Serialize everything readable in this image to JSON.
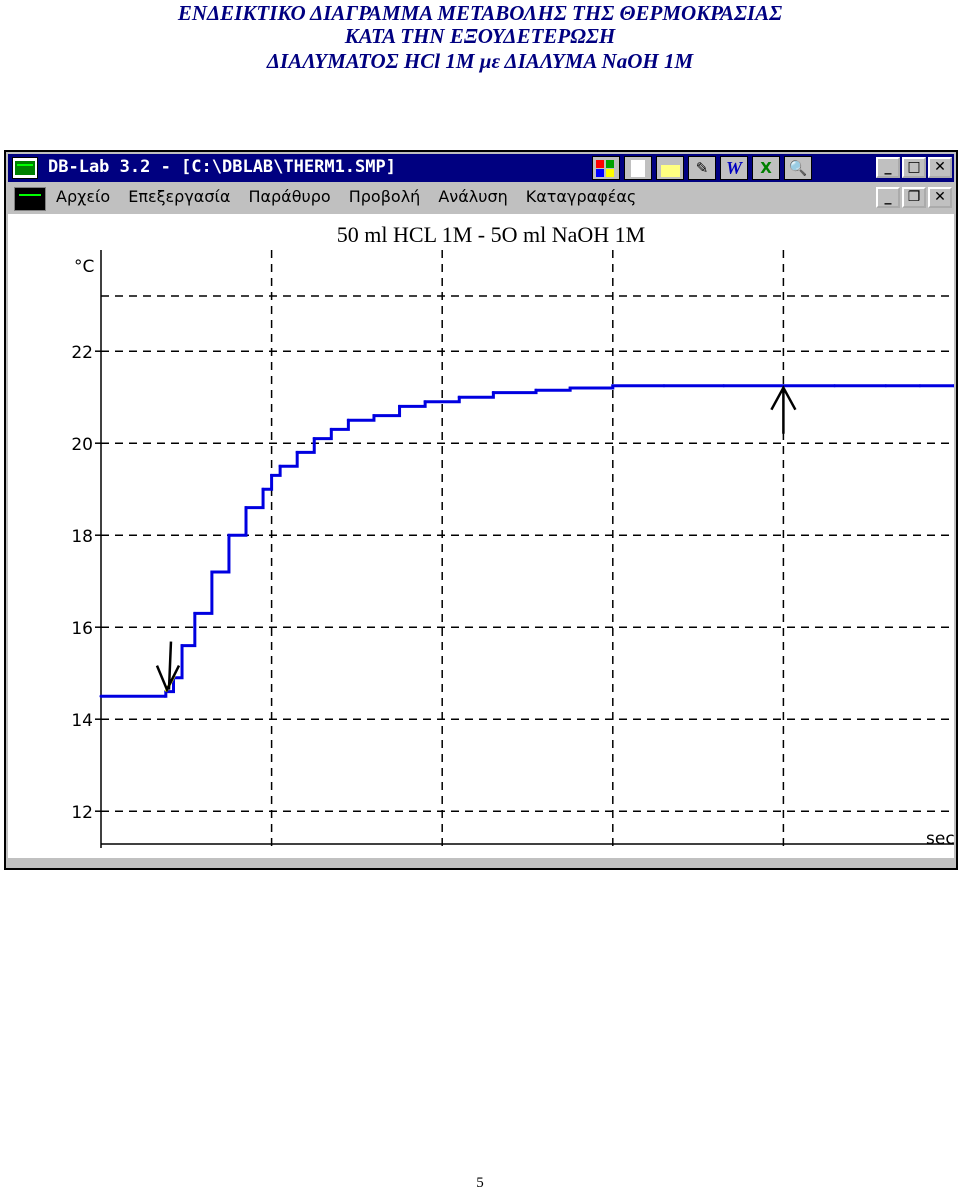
{
  "document": {
    "title_line1": "ΕΝΔΕΙΚΤΙΚΟ ΔΙΑΓΡΑΜΜΑ  ΜΕΤΑΒΟΛΗΣ ΤΗΣ ΘΕΡΜΟΚΡΑΣΙΑΣ",
    "title_line2": "ΚΑΤΑ ΤΗΝ ΕΞΟΥΔΕΤΕΡΩΣΗ",
    "title_line3": "ΔΙΑΛΥΜΑΤΟΣ  HCl 1M με ΔΙΑΛΥΜΑ NaOH 1M",
    "title_color": "#000080",
    "page_number": "5"
  },
  "window": {
    "title": "DB-Lab 3.2 - [C:\\DBLAB\\THERM1.SMP]",
    "title_bar_color": "#000080",
    "toolbar_icons": [
      "color-grid-icon",
      "document-icon",
      "open-folder-icon",
      "notebook-icon",
      "word-icon",
      "excel-icon",
      "magnifier-icon"
    ],
    "toolbar_glyphs": {
      "word": "W",
      "excel": "X",
      "magnifier": "🔍",
      "notebook": "✎"
    },
    "buttons": {
      "minimize": "_",
      "maximize": "□",
      "restore": "❐",
      "close": "✕"
    }
  },
  "menu": {
    "items": [
      "Αρχείο",
      "Επεξεργασία",
      "Παράθυρο",
      "Προβολή",
      "Ανάλυση",
      "Καταγραφέας"
    ]
  },
  "chart_data": {
    "type": "line",
    "title": "50 ml HCL 1M - 5O ml NaOH 1M",
    "ylabel": "°C",
    "xlabel": "sec",
    "ylim": [
      11.2,
      24.2
    ],
    "xlim": [
      0,
      100
    ],
    "yticks": [
      12,
      14,
      16,
      18,
      20,
      22
    ],
    "grid": true,
    "grid_style": "dashed",
    "line_color": "#0000e0",
    "highlight_color": "#ffff00",
    "series": [
      {
        "x": [
          0,
          7.5,
          7.6,
          8.5,
          9.5,
          11,
          13,
          15,
          17,
          19,
          20,
          21,
          23,
          25,
          27,
          29,
          32,
          35,
          38,
          42,
          46,
          51,
          55,
          60,
          66,
          73,
          80,
          86,
          92,
          96,
          100
        ],
        "y": [
          14.5,
          14.5,
          14.6,
          14.9,
          15.6,
          16.3,
          17.2,
          18.0,
          18.6,
          19.0,
          19.3,
          19.5,
          19.8,
          20.1,
          20.3,
          20.5,
          20.6,
          20.8,
          20.9,
          21.0,
          21.1,
          21.15,
          21.2,
          21.25,
          21.25,
          21.25,
          21.25,
          21.25,
          21.25,
          21.25,
          21.25
        ]
      }
    ],
    "annotations": [
      {
        "type": "down-arrow",
        "x": 7.5,
        "y": 14.6
      },
      {
        "type": "up-arrow",
        "x": 80,
        "y": 21.25
      }
    ]
  }
}
